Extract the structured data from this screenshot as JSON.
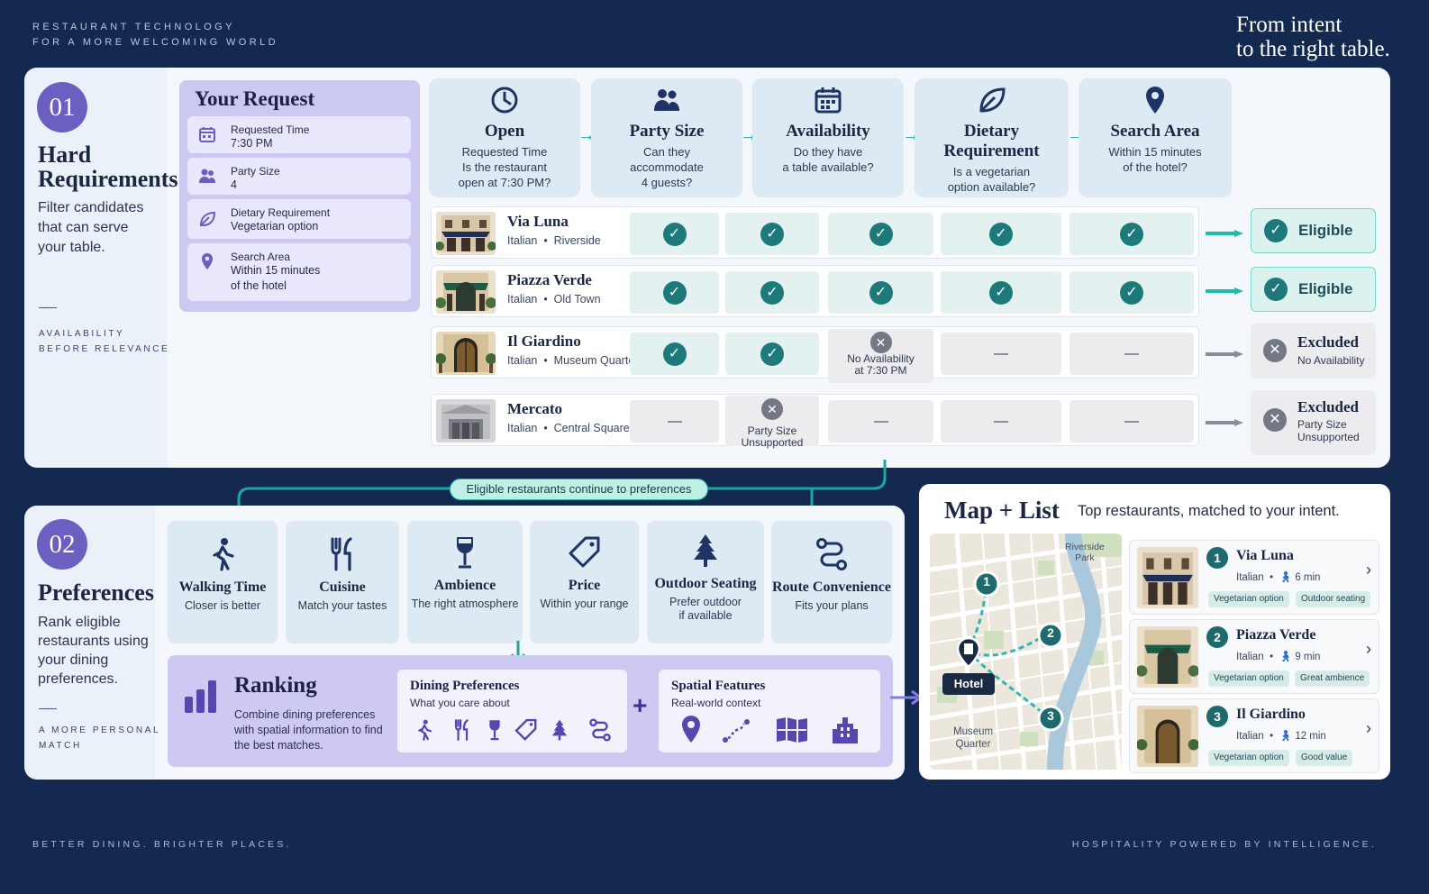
{
  "header": {
    "caption_line1": "RESTAURANT TECHNOLOGY",
    "caption_line2": "FOR A MORE WELCOMING WORLD",
    "tagline_line1": "From intent",
    "tagline_line2": "to the right table."
  },
  "footer": {
    "left": "BETTER DINING. BRIGHTER PLACES.",
    "right": "HOSPITALITY POWERED BY INTELLIGENCE."
  },
  "section1": {
    "number": "01",
    "title_line1": "Hard",
    "title_line2": "Requirements",
    "desc": "Filter candidates that can serve your table.",
    "caption_line1": "AVAILABILITY",
    "caption_line2": "BEFORE RELEVANCE"
  },
  "request": {
    "title": "Your Request",
    "items": [
      {
        "label": "Requested Time",
        "value": "7:30 PM"
      },
      {
        "label": "Party Size",
        "value": "4"
      },
      {
        "label": "Dietary Requirement",
        "value": "Vegetarian option"
      },
      {
        "label": "Search Area",
        "value_line1": "Within 15 minutes",
        "value_line2": "of the hotel"
      }
    ]
  },
  "criteria": [
    {
      "title": "Open",
      "desc_line1": "Requested Time",
      "desc_line2": "Is the restaurant",
      "desc_line3": "open at 7:30 PM?"
    },
    {
      "title": "Party Size",
      "desc_line1": "Can they",
      "desc_line2": "accommodate",
      "desc_line3": "4 guests?"
    },
    {
      "title": "Availability",
      "desc_line1": "Do they have",
      "desc_line2": "a table available?",
      "desc_line3": ""
    },
    {
      "title": "Dietary Requirement",
      "desc_line1": "Is a vegetarian",
      "desc_line2": "option available?",
      "desc_line3": ""
    },
    {
      "title": "Search Area",
      "desc_line1": "Within 15 minutes",
      "desc_line2": "of the hotel?",
      "desc_line3": ""
    }
  ],
  "restaurants": [
    {
      "name": "Via Luna",
      "cuisine": "Italian",
      "area": "Riverside",
      "status": "Eligible"
    },
    {
      "name": "Piazza Verde",
      "cuisine": "Italian",
      "area": "Old Town",
      "status": "Eligible"
    },
    {
      "name": "Il Giardino",
      "cuisine": "Italian",
      "area": "Museum Quarter",
      "status": "Excluded",
      "note_line1": "No Availability",
      "note_line2": "at 7:30 PM",
      "status_detail": "No Availability"
    },
    {
      "name": "Mercato",
      "cuisine": "Italian",
      "area": "Central Square",
      "status": "Excluded",
      "note_line1": "Party Size",
      "note_line2": "Unsupported",
      "status_detail_line1": "Party Size",
      "status_detail_line2": "Unsupported"
    }
  ],
  "separator": "•",
  "pill": "Eligible restaurants continue to preferences",
  "section2": {
    "number": "02",
    "title": "Preferences",
    "desc": "Rank eligible restaurants using your dining preferences.",
    "caption_line1": "A MORE PERSONAL",
    "caption_line2": "MATCH"
  },
  "preferences": [
    {
      "title": "Walking Time",
      "desc_line1": "Closer is better",
      "desc_line2": ""
    },
    {
      "title": "Cuisine",
      "desc_line1": "Match your tastes",
      "desc_line2": ""
    },
    {
      "title": "Ambience",
      "desc_line1": "The right atmosphere",
      "desc_line2": ""
    },
    {
      "title": "Price",
      "desc_line1": "Within your range",
      "desc_line2": ""
    },
    {
      "title": "Outdoor Seating",
      "desc_line1": "Prefer outdoor",
      "desc_line2": "if available"
    },
    {
      "title": "Route Convenience",
      "desc_line1": "Fits your plans",
      "desc_line2": ""
    }
  ],
  "ranking": {
    "title": "Ranking",
    "desc_line1": "Combine dining preferences",
    "desc_line2": "with spatial information to find",
    "desc_line3": "the best matches.",
    "dining_title": "Dining Preferences",
    "dining_sub": "What you care about",
    "plus": "+",
    "spatial_title": "Spatial Features",
    "spatial_sub": "Real-world context"
  },
  "map": {
    "title": "Map + List",
    "subtitle": "Top restaurants, matched to your intent.",
    "label_riverside_line1": "Riverside",
    "label_riverside_line2": "Park",
    "label_museum_line1": "Museum",
    "label_museum_line2": "Quarter",
    "hotel": "Hotel",
    "pin1": "1",
    "pin2": "2",
    "pin3": "3"
  },
  "results": [
    {
      "rank": "1",
      "name": "Via Luna",
      "cuisine": "Italian",
      "walk": "6 min",
      "tag1": "Vegetarian option",
      "tag2": "Outdoor seating"
    },
    {
      "rank": "2",
      "name": "Piazza Verde",
      "cuisine": "Italian",
      "walk": "9 min",
      "tag1": "Vegetarian option",
      "tag2": "Great ambience"
    },
    {
      "rank": "3",
      "name": "Il Giardino",
      "cuisine": "Italian",
      "walk": "12 min",
      "tag1": "Vegetarian option",
      "tag2": "Good value"
    }
  ],
  "colors": {
    "background": "#14294f",
    "accent_purple": "#6b5fc2",
    "accent_teal": "#1e7a7a",
    "excluded_gray": "#747784"
  }
}
